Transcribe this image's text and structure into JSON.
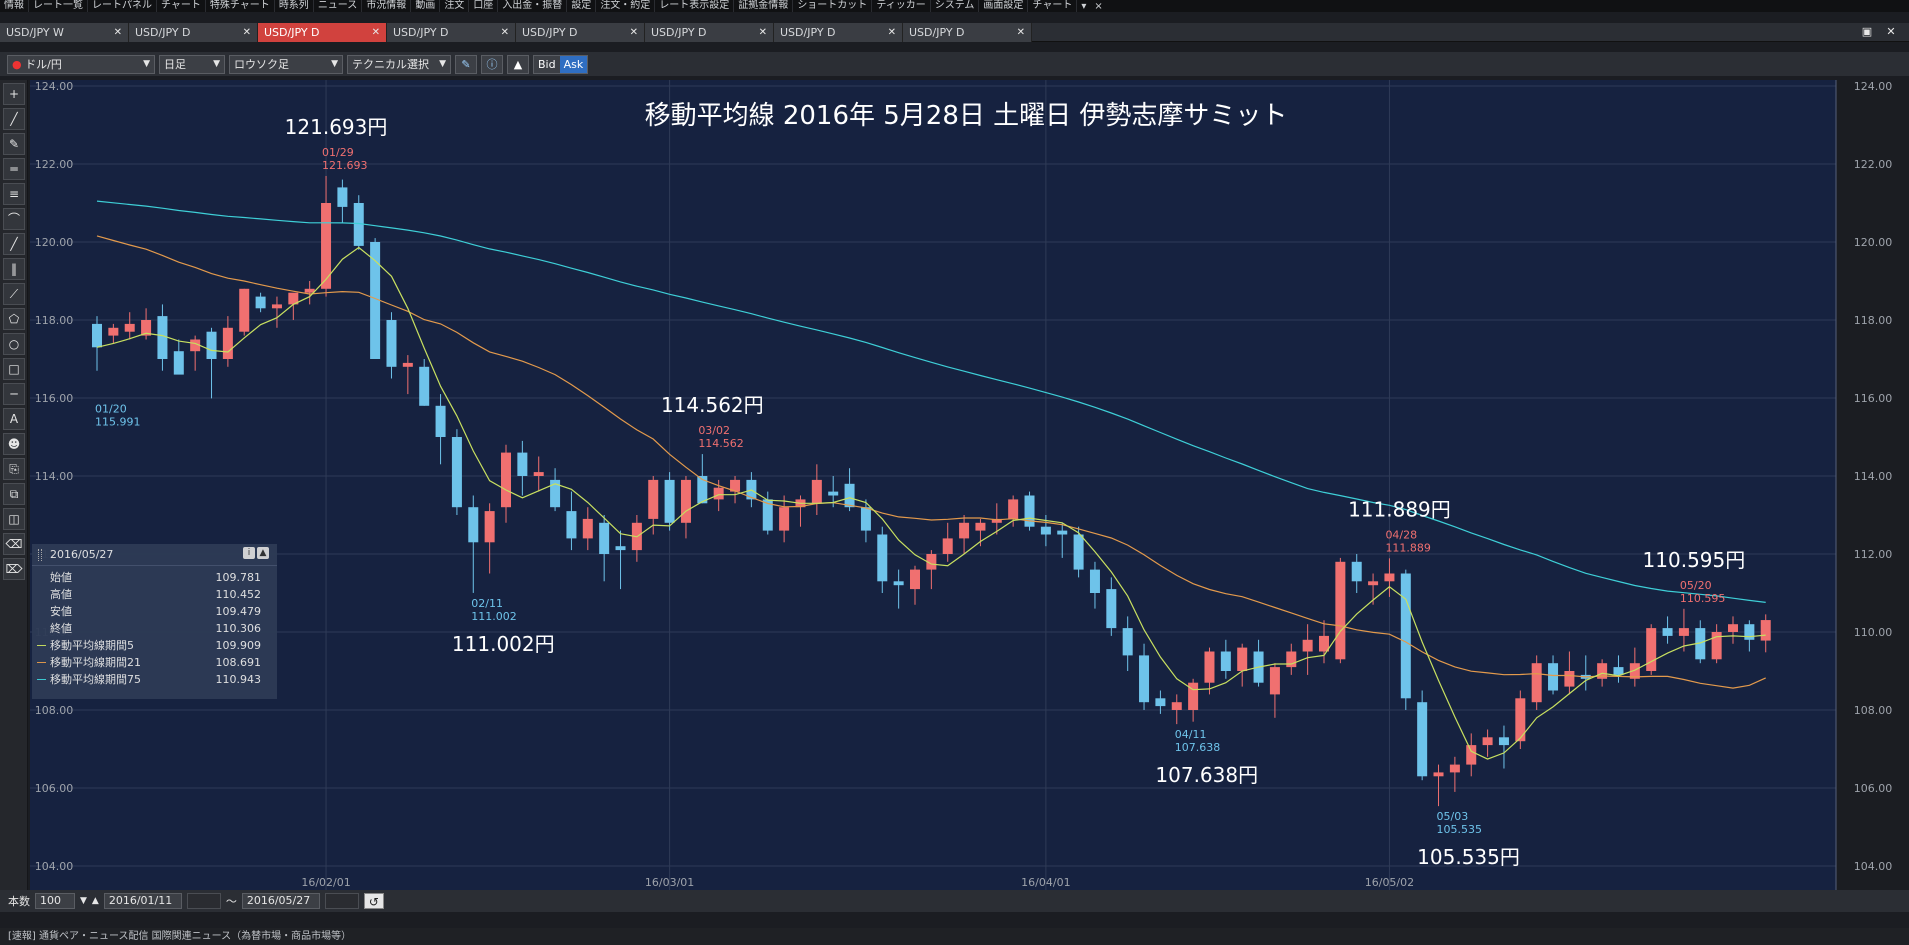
{
  "menubar": {
    "items": [
      "情報",
      "レート一覧",
      "レートパネル",
      "チャート",
      "特殊チャート",
      "時系列",
      "ニュース",
      "市況情報",
      "動画",
      "注文",
      "口座",
      "入出金・振替",
      "設定",
      "注文・約定",
      "レート表示設定",
      "証拠金情報",
      "ショートカット",
      "ティッカー",
      "システム",
      "画面設定",
      "チャート"
    ],
    "more": "▾",
    "close": "×"
  },
  "tabs": [
    {
      "label": "USD/JPY W",
      "active": false
    },
    {
      "label": "USD/JPY D",
      "active": false
    },
    {
      "label": "USD/JPY D",
      "active": true
    },
    {
      "label": "USD/JPY D",
      "active": false
    },
    {
      "label": "USD/JPY D",
      "active": false
    },
    {
      "label": "USD/JPY D",
      "active": false
    },
    {
      "label": "USD/JPY D",
      "active": false
    },
    {
      "label": "USD/JPY D",
      "active": false
    }
  ],
  "toolbar": {
    "pair": "ドル/円",
    "period": "日足",
    "chart_type": "ロウソク足",
    "technical": "テクニカル選択",
    "bid": "Bid",
    "ask": "Ask"
  },
  "palette": {
    "icons": [
      "crosshair-icon",
      "line-icon",
      "ruler-icon",
      "hline-icon",
      "multi-hline-icon",
      "arc-icon",
      "channel-icon",
      "vlines-icon",
      "pitchfork-icon",
      "pentagon-icon",
      "circle-icon",
      "rectangle-icon",
      "separator-icon",
      "text-icon",
      "stamp-icon",
      "copy-icon",
      "clone-icon",
      "lock-icon",
      "eraser-icon",
      "eraser-all-icon"
    ],
    "glyphs": [
      "+",
      "╱",
      "✎",
      "═",
      "≡",
      "⌒",
      "╱",
      "‖",
      "⟋",
      "⬠",
      "○",
      "□",
      "─",
      "A",
      "☻",
      "⎘",
      "⧉",
      "◫",
      "⌫",
      "⌦"
    ]
  },
  "chart": {
    "title": "移動平均線 2016年 5月28日 土曜日 伊勢志摩サミット",
    "colors": {
      "bg": "#162240",
      "up": "#f07070",
      "down": "#6ec3ea",
      "ma5": "#c8e060",
      "ma21": "#e39a4c",
      "ma75": "#3ecfd7",
      "grid": "#2f3b57"
    },
    "annotations": [
      {
        "type": "high",
        "date": "01/29",
        "price": "121.693",
        "big": "121.693円"
      },
      {
        "type": "low",
        "date": "01/20",
        "price": "115.991",
        "big": ""
      },
      {
        "type": "low",
        "date": "02/11",
        "price": "111.002",
        "big": "111.002円"
      },
      {
        "type": "high",
        "date": "03/02",
        "price": "114.562",
        "big": "114.562円"
      },
      {
        "type": "low",
        "date": "04/11",
        "price": "107.638",
        "big": "107.638円"
      },
      {
        "type": "high",
        "date": "04/28",
        "price": "111.889",
        "big": "111.889円"
      },
      {
        "type": "low",
        "date": "05/03",
        "price": "105.535",
        "big": "105.535円"
      },
      {
        "type": "high",
        "date": "05/20",
        "price": "110.595",
        "big": "110.595円"
      }
    ]
  },
  "chart_data": {
    "type": "candlestick",
    "pair": "USD/JPY",
    "yticks": [
      "124.00",
      "122.00",
      "120.00",
      "118.00",
      "116.00",
      "114.00",
      "112.00",
      "110.00",
      "108.00",
      "106.00",
      "104.00"
    ],
    "ylim": [
      104,
      124
    ],
    "xticks": [
      {
        "label": "16/02/01",
        "index": 14
      },
      {
        "label": "16/03/01",
        "index": 35
      },
      {
        "label": "16/04/01",
        "index": 58
      },
      {
        "label": "16/05/02",
        "index": 79
      }
    ],
    "candles": [
      [
        117.9,
        118.1,
        116.7,
        117.3
      ],
      [
        117.6,
        117.9,
        117.4,
        117.8
      ],
      [
        117.7,
        118.2,
        117.5,
        117.9
      ],
      [
        117.6,
        118.3,
        117.5,
        118.0
      ],
      [
        118.1,
        118.4,
        116.7,
        117.0
      ],
      [
        117.2,
        117.5,
        116.7,
        116.6
      ],
      [
        117.2,
        117.6,
        116.7,
        117.5
      ],
      [
        117.7,
        117.8,
        115.99,
        117.0
      ],
      [
        117.0,
        118.1,
        116.8,
        117.8
      ],
      [
        117.7,
        118.8,
        117.6,
        118.8
      ],
      [
        118.6,
        118.7,
        118.2,
        118.3
      ],
      [
        118.3,
        118.6,
        117.8,
        118.4
      ],
      [
        118.4,
        118.6,
        118.0,
        118.7
      ],
      [
        118.7,
        119.0,
        118.4,
        118.8
      ],
      [
        118.8,
        121.693,
        118.6,
        121.0
      ],
      [
        121.4,
        121.6,
        120.5,
        120.9
      ],
      [
        121.0,
        121.2,
        119.8,
        119.9
      ],
      [
        120.0,
        120.1,
        117.2,
        117.0
      ],
      [
        118.0,
        118.2,
        116.5,
        116.8
      ],
      [
        116.8,
        117.1,
        116.1,
        116.9
      ],
      [
        116.8,
        117.0,
        115.8,
        115.8
      ],
      [
        115.8,
        116.1,
        114.3,
        115.0
      ],
      [
        115.0,
        115.2,
        113.0,
        113.2
      ],
      [
        113.2,
        113.5,
        111.002,
        112.3
      ],
      [
        112.3,
        113.3,
        111.5,
        113.1
      ],
      [
        113.2,
        114.8,
        112.8,
        114.6
      ],
      [
        114.6,
        114.9,
        113.5,
        114.0
      ],
      [
        114.0,
        114.5,
        113.6,
        114.1
      ],
      [
        113.9,
        114.2,
        113.1,
        113.2
      ],
      [
        113.1,
        113.6,
        112.1,
        112.4
      ],
      [
        112.4,
        113.2,
        112.1,
        112.9
      ],
      [
        112.8,
        113.0,
        111.3,
        112.0
      ],
      [
        112.2,
        112.6,
        111.1,
        112.1
      ],
      [
        112.1,
        113.0,
        111.8,
        112.8
      ],
      [
        112.9,
        114.0,
        112.5,
        113.9
      ],
      [
        113.9,
        114.1,
        112.6,
        112.8
      ],
      [
        112.8,
        114.0,
        112.4,
        113.9
      ],
      [
        114.0,
        114.562,
        113.3,
        113.3
      ],
      [
        113.4,
        113.9,
        113.1,
        113.7
      ],
      [
        113.6,
        114.0,
        113.3,
        113.9
      ],
      [
        113.9,
        114.1,
        113.2,
        113.4
      ],
      [
        113.4,
        113.6,
        112.5,
        112.6
      ],
      [
        112.6,
        113.5,
        112.3,
        113.2
      ],
      [
        113.2,
        113.5,
        112.7,
        113.4
      ],
      [
        113.3,
        114.3,
        113.0,
        113.9
      ],
      [
        113.6,
        114.0,
        113.2,
        113.5
      ],
      [
        113.8,
        114.2,
        113.1,
        113.2
      ],
      [
        113.2,
        113.4,
        112.3,
        112.6
      ],
      [
        112.5,
        112.7,
        111.0,
        111.3
      ],
      [
        111.3,
        111.6,
        110.6,
        111.2
      ],
      [
        111.1,
        111.7,
        110.7,
        111.6
      ],
      [
        111.6,
        112.1,
        111.1,
        112.0
      ],
      [
        112.0,
        112.8,
        111.8,
        112.4
      ],
      [
        112.4,
        113.0,
        112.0,
        112.8
      ],
      [
        112.6,
        112.9,
        112.2,
        112.8
      ],
      [
        112.8,
        113.3,
        112.5,
        112.9
      ],
      [
        112.9,
        113.5,
        112.7,
        113.4
      ],
      [
        113.5,
        113.6,
        112.6,
        112.7
      ],
      [
        112.7,
        113.0,
        112.2,
        112.5
      ],
      [
        112.6,
        112.8,
        111.9,
        112.5
      ],
      [
        112.5,
        112.7,
        111.4,
        111.6
      ],
      [
        111.6,
        111.8,
        110.6,
        111.0
      ],
      [
        111.1,
        111.4,
        109.9,
        110.1
      ],
      [
        110.1,
        110.4,
        109.0,
        109.4
      ],
      [
        109.4,
        109.7,
        108.0,
        108.2
      ],
      [
        108.3,
        108.5,
        107.9,
        108.1
      ],
      [
        108.0,
        108.4,
        107.638,
        108.2
      ],
      [
        108.0,
        108.8,
        107.7,
        108.7
      ],
      [
        108.7,
        109.6,
        108.4,
        109.5
      ],
      [
        109.5,
        109.8,
        108.8,
        109.0
      ],
      [
        109.0,
        109.7,
        108.6,
        109.6
      ],
      [
        109.5,
        109.8,
        108.6,
        108.7
      ],
      [
        108.4,
        109.2,
        107.8,
        109.1
      ],
      [
        109.1,
        109.7,
        108.9,
        109.5
      ],
      [
        109.5,
        110.2,
        108.9,
        109.8
      ],
      [
        109.5,
        110.3,
        109.2,
        109.9
      ],
      [
        109.3,
        111.9,
        109.2,
        111.8
      ],
      [
        111.8,
        112.0,
        111.0,
        111.3
      ],
      [
        111.2,
        111.5,
        110.7,
        111.3
      ],
      [
        111.3,
        111.889,
        110.9,
        111.5
      ],
      [
        111.5,
        111.6,
        108.0,
        108.3
      ],
      [
        108.2,
        108.5,
        106.2,
        106.3
      ],
      [
        106.3,
        106.6,
        105.535,
        106.4
      ],
      [
        106.4,
        106.8,
        105.9,
        106.6
      ],
      [
        106.6,
        107.4,
        106.3,
        107.1
      ],
      [
        107.1,
        107.5,
        106.8,
        107.3
      ],
      [
        107.3,
        107.6,
        106.5,
        107.1
      ],
      [
        107.2,
        108.5,
        107.0,
        108.3
      ],
      [
        108.2,
        109.4,
        108.0,
        109.2
      ],
      [
        109.2,
        109.4,
        108.4,
        108.5
      ],
      [
        108.6,
        109.5,
        108.4,
        109.0
      ],
      [
        108.9,
        109.4,
        108.5,
        108.8
      ],
      [
        108.8,
        109.3,
        108.6,
        109.2
      ],
      [
        109.1,
        109.4,
        108.7,
        108.9
      ],
      [
        108.8,
        109.6,
        108.6,
        109.2
      ],
      [
        109.0,
        110.2,
        108.9,
        110.1
      ],
      [
        110.1,
        110.4,
        109.7,
        109.9
      ],
      [
        109.9,
        110.595,
        109.5,
        110.1
      ],
      [
        110.1,
        110.3,
        109.2,
        109.3
      ],
      [
        109.3,
        110.2,
        109.2,
        110.0
      ],
      [
        110.0,
        110.4,
        109.7,
        110.2
      ],
      [
        110.2,
        110.3,
        109.5,
        109.8
      ],
      [
        109.78,
        110.452,
        109.479,
        110.306
      ]
    ],
    "candle_format": [
      "open",
      "high",
      "low",
      "close"
    ],
    "legend": [
      "移動平均線期間5",
      "移動平均線期間21",
      "移動平均線期間75"
    ],
    "ma75_start": 121.1,
    "ma21_start": 120.3
  },
  "info_panel": {
    "date": "2016/05/27",
    "rows": [
      {
        "label": "始値",
        "value": "109.781",
        "color": ""
      },
      {
        "label": "高値",
        "value": "110.452",
        "color": ""
      },
      {
        "label": "安値",
        "value": "109.479",
        "color": ""
      },
      {
        "label": "終値",
        "value": "110.306",
        "color": ""
      },
      {
        "label": "移動平均線期間5",
        "value": "109.909",
        "color": "#c8e060"
      },
      {
        "label": "移動平均線期間21",
        "value": "108.691",
        "color": "#e39a4c"
      },
      {
        "label": "移動平均線期間75",
        "value": "110.943",
        "color": "#3ecfd7"
      }
    ]
  },
  "bottombar": {
    "count_label": "本数",
    "count_value": "100",
    "from_date": "2016/01/11",
    "tilde": "〜",
    "to_date": "2016/05/27",
    "reset": "↺"
  },
  "statusbar": {
    "text": "[速報] 通貨ペア・ニュース配信 国際関連ニュース（為替市場・商品市場等）"
  }
}
